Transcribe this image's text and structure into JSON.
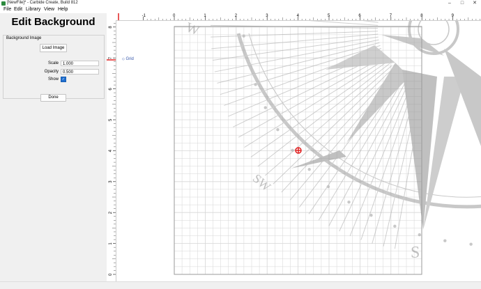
{
  "window": {
    "title": "[NewFile]* - Carbide Create, Build 812",
    "minimize": "–",
    "maximize": "□",
    "close": "✕"
  },
  "menu": {
    "items": [
      "File",
      "Edit",
      "Library",
      "View",
      "Help"
    ]
  },
  "panel": {
    "title": "Edit Background",
    "group_label": "Background Image",
    "load_image": "Load Image",
    "scale_label": "Scale",
    "scale_value": "1.000",
    "opacity_label": "Opacity",
    "opacity_value": "0.500",
    "show_label": "Show",
    "show_checked": true,
    "done": "Done"
  },
  "canvas": {
    "grid_toggle_label": "Grid",
    "h_ruler_ticks": [
      "-1",
      "0",
      "1",
      "2",
      "3",
      "4",
      "5",
      "6",
      "7",
      "8",
      "9"
    ],
    "v_ruler_ticks": [
      "8",
      "7",
      "6",
      "5",
      "4",
      "3",
      "2",
      "1",
      "0"
    ],
    "compass_letters": [
      "W",
      "SW",
      "S"
    ]
  },
  "colors": {
    "grid_line": "#d6d6d6",
    "stock_border": "#9a9a9a",
    "compass_gray": "#b8b8b8",
    "accent_blue": "#1f6fd0",
    "marker_red": "#e02020"
  }
}
